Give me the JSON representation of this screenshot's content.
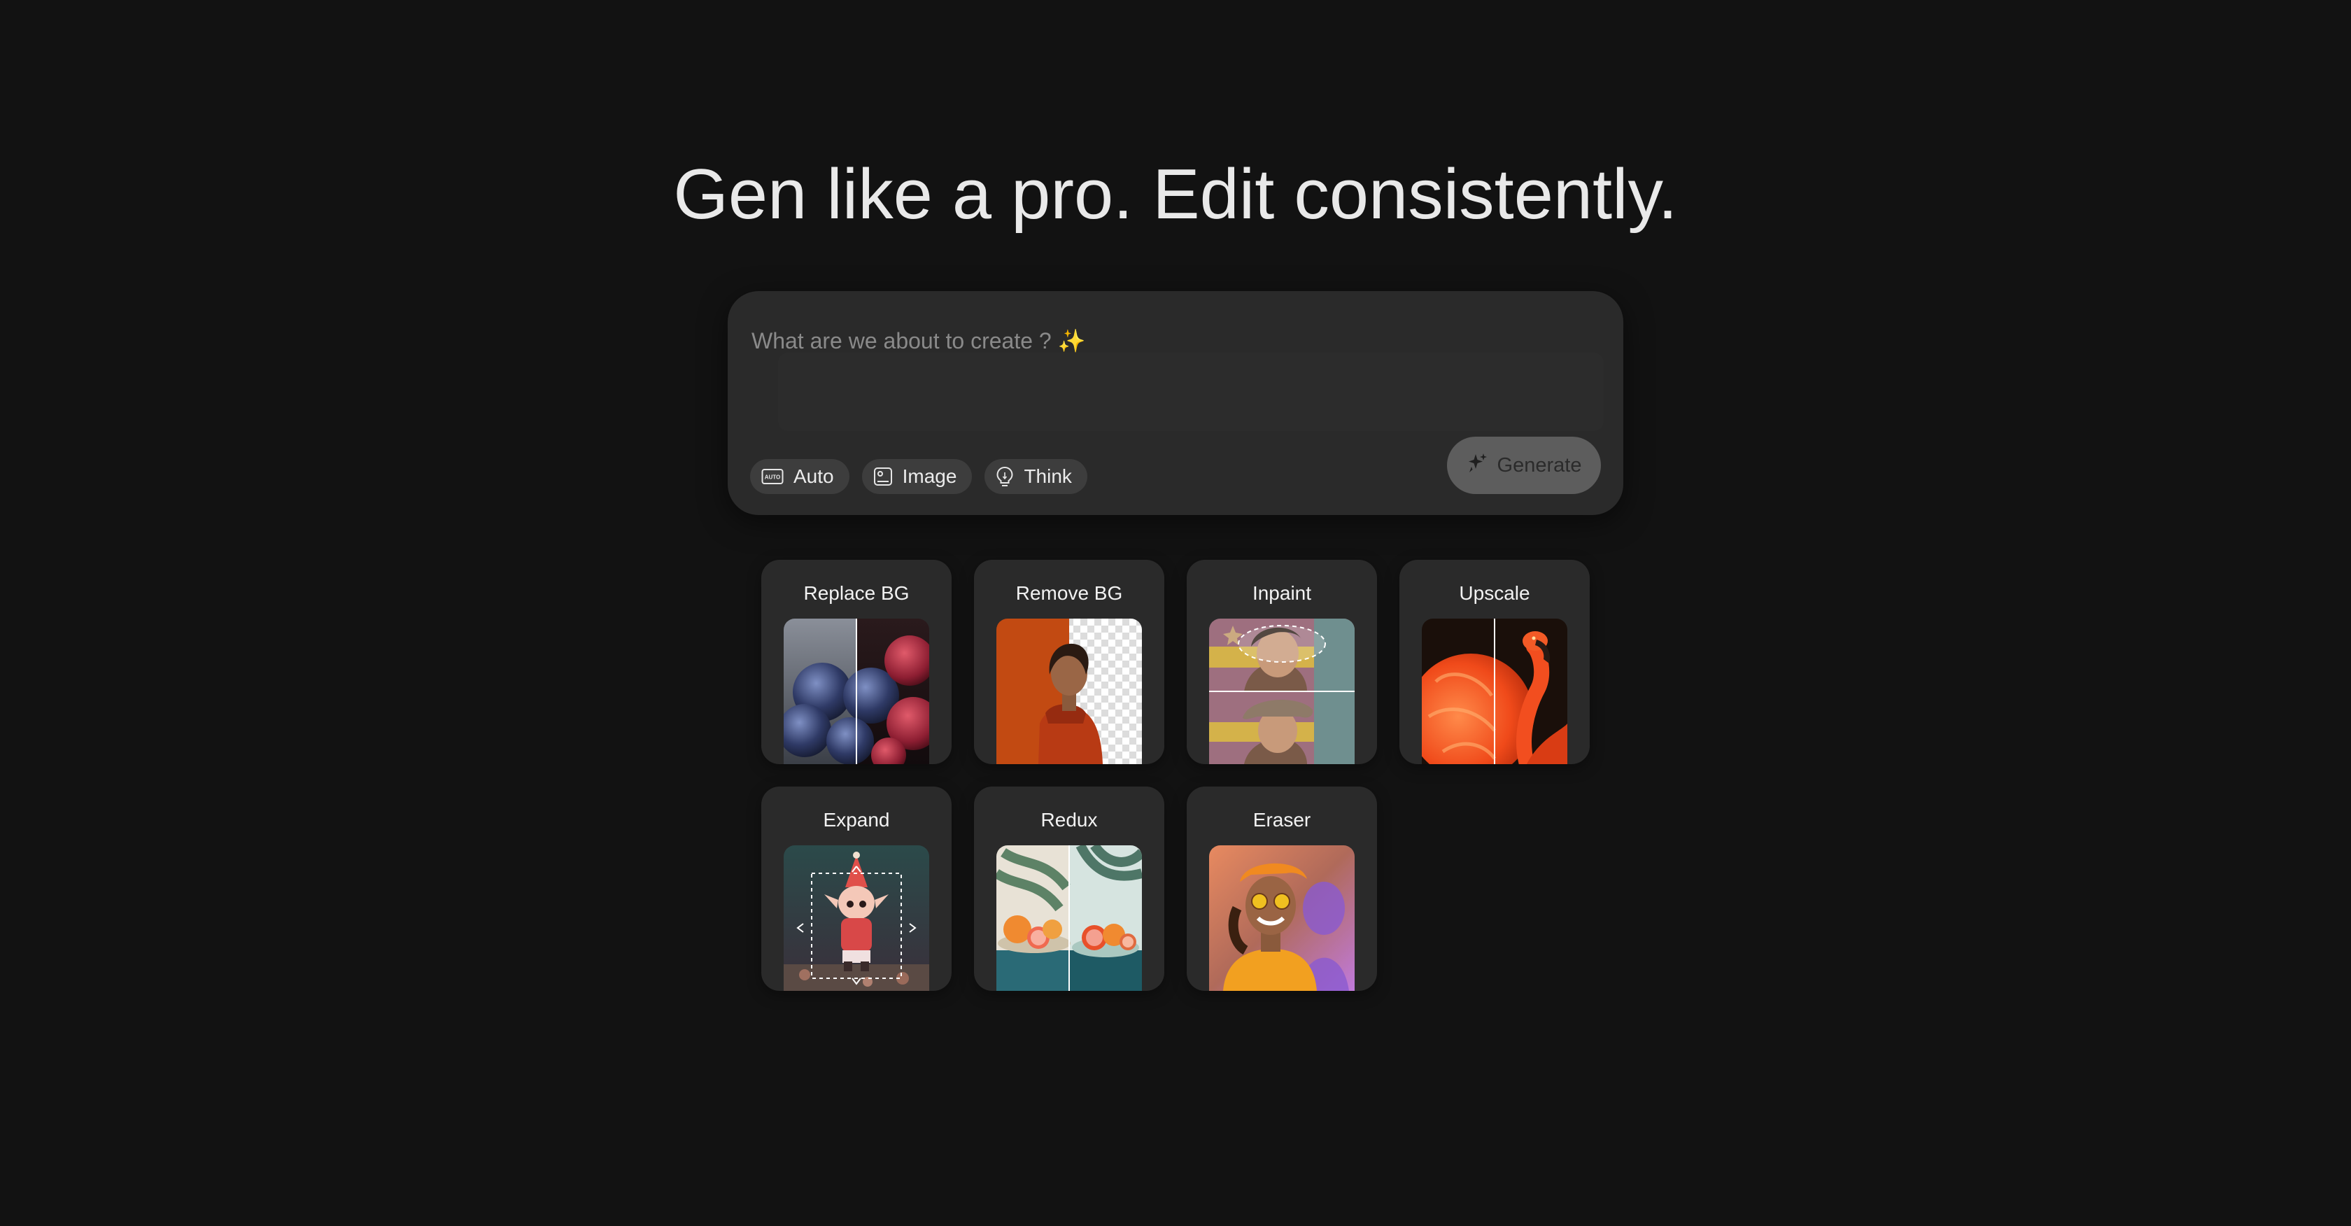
{
  "hero": {
    "headline": "Gen like a pro. Edit consistently."
  },
  "prompt": {
    "placeholder": "What are we about to create ? ✨",
    "value": "",
    "chips": [
      {
        "label": "Auto",
        "icon": "auto-icon"
      },
      {
        "label": "Image",
        "icon": "image-icon"
      },
      {
        "label": "Think",
        "icon": "lightbulb-icon"
      }
    ],
    "generate_label": "Generate"
  },
  "tools": [
    {
      "label": "Replace BG"
    },
    {
      "label": "Remove BG"
    },
    {
      "label": "Inpaint"
    },
    {
      "label": "Upscale"
    },
    {
      "label": "Expand"
    },
    {
      "label": "Redux"
    },
    {
      "label": "Eraser"
    }
  ],
  "colors": {
    "background": "#121212",
    "panel": "#2a2a2a",
    "chip": "#3d3d3d",
    "generate_button": "#5d5d5d"
  }
}
